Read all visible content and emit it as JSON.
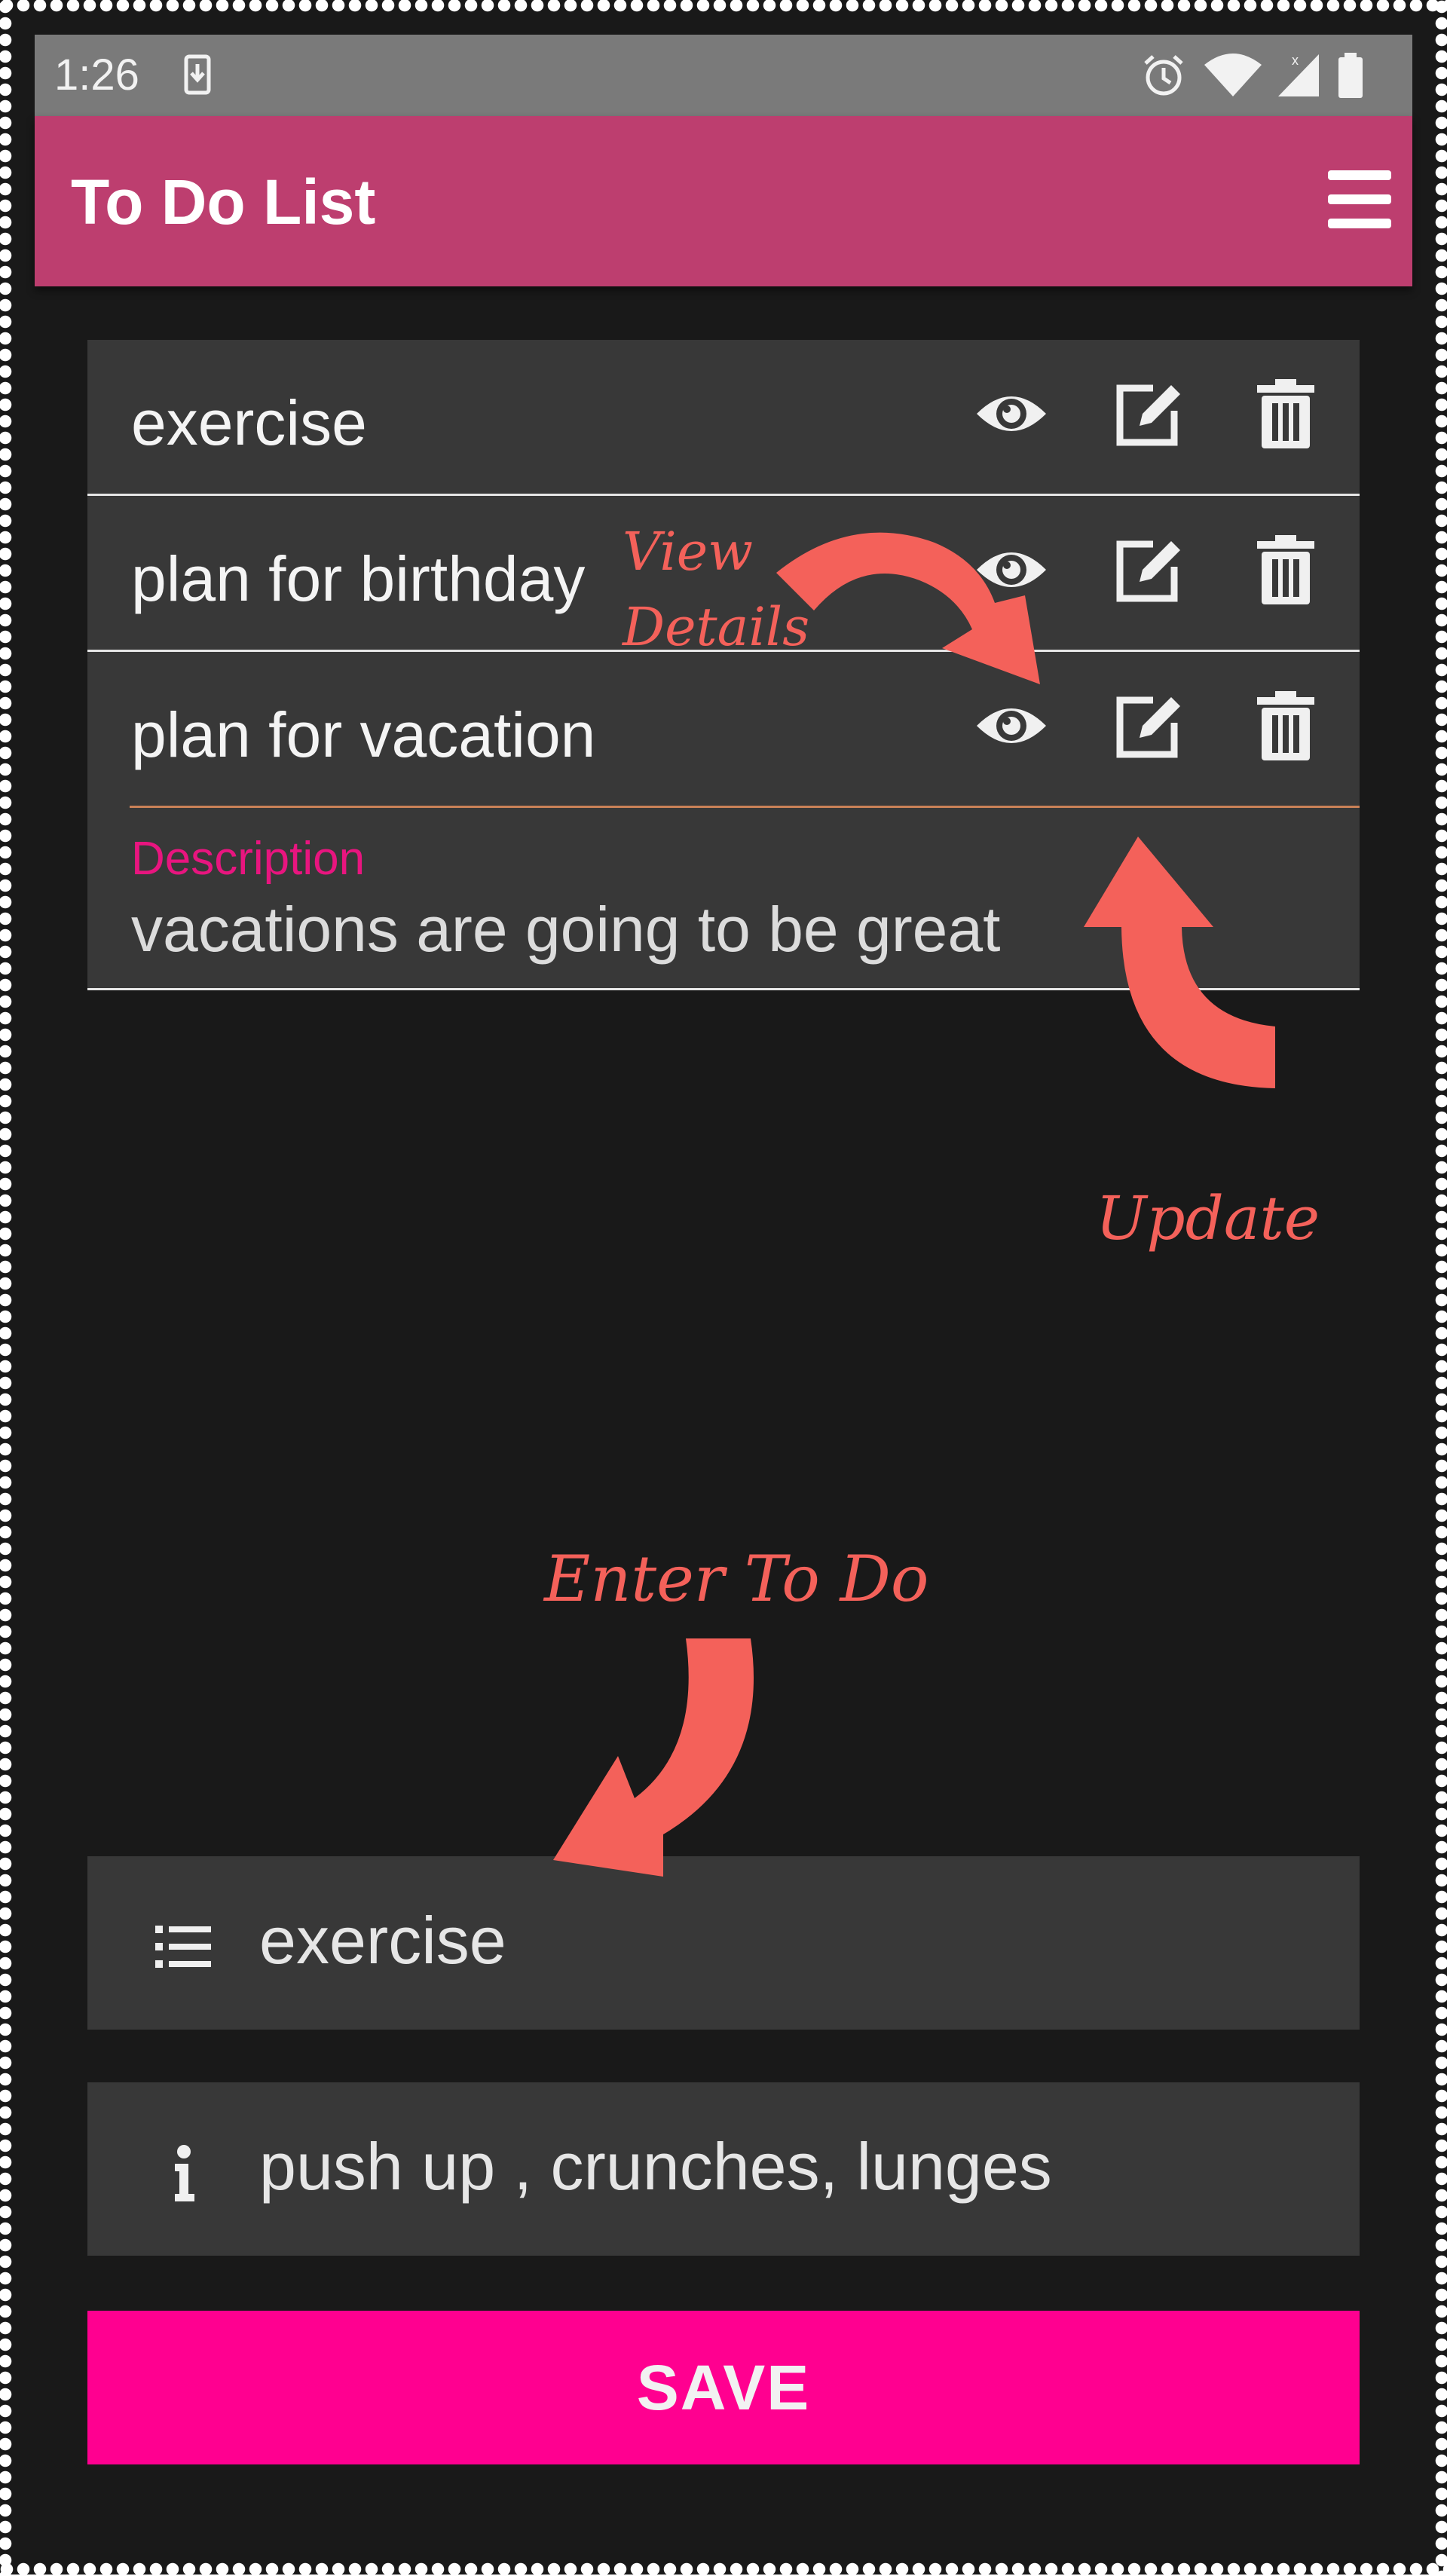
{
  "status_bar": {
    "time": "1:26"
  },
  "app_bar": {
    "title": "To Do List",
    "menu_icon": "hamburger-menu-icon"
  },
  "todos": [
    {
      "title": "exercise"
    },
    {
      "title": "plan for birthday"
    },
    {
      "title": "plan for vacation"
    }
  ],
  "details": {
    "label": "Description",
    "value": "vacations are going to be great"
  },
  "form": {
    "todo_value": "exercise",
    "description_value": "push up , crunches, lunges",
    "save_label": "SAVE"
  },
  "annotations": {
    "view_line1": "View",
    "view_line2": "Details",
    "update": "Update",
    "enter": "Enter To Do"
  },
  "colors": {
    "app_bar": "#bd3e6f",
    "accent": "#ff0090",
    "annotation": "#f4615a",
    "background": "#191919",
    "row": "#383838"
  }
}
